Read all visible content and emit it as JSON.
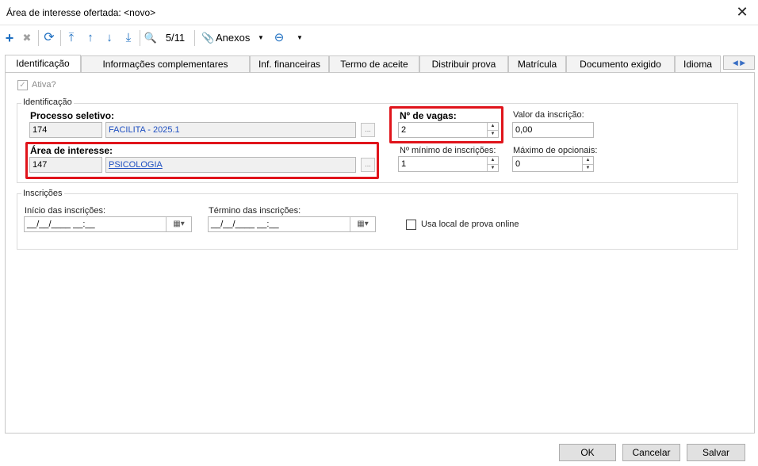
{
  "window": {
    "title": "Área de interesse ofertada: <novo>"
  },
  "toolbar": {
    "add_icon": "+",
    "delete_icon": "✖",
    "refresh_icon": "⟳",
    "first_icon": "⤒",
    "prev_icon": "↑",
    "next_icon": "↓",
    "last_icon": "⤓",
    "search_icon": "🔍",
    "record_counter": "5/11",
    "attachments_label": "Anexos",
    "attachments_icon": "📎",
    "dropdown_arrow": "▼",
    "extra_icon": "⊖"
  },
  "tabs": [
    "Identificação",
    "Informações complementares",
    "Inf. financeiras",
    "Termo de aceite",
    "Distribuir prova",
    "Matrícula",
    "Documento exigido",
    "Idioma"
  ],
  "tab_arrows": "◀ ▶",
  "active_label": "Ativa?",
  "identificacao": {
    "group_label": "Identificação",
    "processo_label": "Processo seletivo:",
    "processo_code": "174",
    "processo_name": "FACILITA - 2025.1",
    "area_label": "Área de interesse:",
    "area_code": "147",
    "area_name": "PSICOLOGIA",
    "ellipsis": "...",
    "vagas_label": "Nº de vagas:",
    "vagas_value": "2",
    "valor_label": "Valor da inscrição:",
    "valor_value": "0,00",
    "min_insc_label": "Nº mínimo de inscrições:",
    "min_insc_value": "1",
    "max_opc_label": "Máximo de opcionais:",
    "max_opc_value": "0"
  },
  "inscricoes": {
    "group_label": "Inscrições",
    "inicio_label": "Início das inscrições:",
    "inicio_value": "__/__/____ __:__",
    "termino_label": "Término das inscrições:",
    "termino_value": "__/__/____ __:__",
    "usa_local_label": "Usa local de prova online"
  },
  "buttons": {
    "ok": "OK",
    "cancel": "Cancelar",
    "save": "Salvar"
  },
  "colors": {
    "highlight": "#e0141b",
    "accent": "#1e6fc1",
    "link": "#1e4fc1"
  }
}
